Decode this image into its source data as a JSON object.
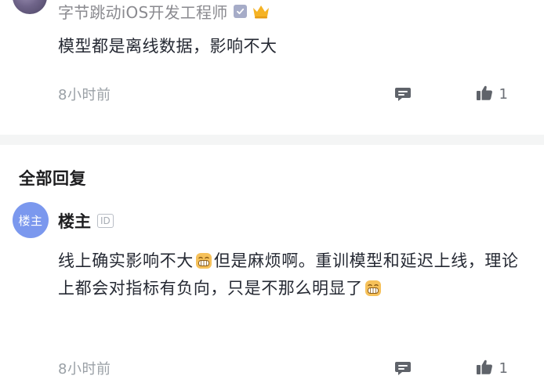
{
  "top_comment": {
    "author": "字节跳动iOS开发工程师",
    "text": "模型都是离线数据，影响不大",
    "time": "8小时前",
    "like_count": "1"
  },
  "replies_section": {
    "title": "全部回复"
  },
  "reply": {
    "avatar_label": "楼主",
    "author": "楼主",
    "id_badge": "ID",
    "text_part1": "线上确实影响不大",
    "text_part2": "但是麻烦啊。重训模型和延迟上线，理论上都会对指标有负向，只是不那么明显了",
    "time": "8小时前",
    "like_count": "1"
  },
  "icons": {
    "verify": "verified-badge-icon",
    "crown": "crown-icon",
    "reply": "comment-icon",
    "like": "thumbs-up-icon",
    "emoji": "grin-emoji-icon"
  },
  "colors": {
    "avatar_lz": "#7b98ee",
    "crown": "#f5b324",
    "icon_gray": "#6b6f76"
  }
}
